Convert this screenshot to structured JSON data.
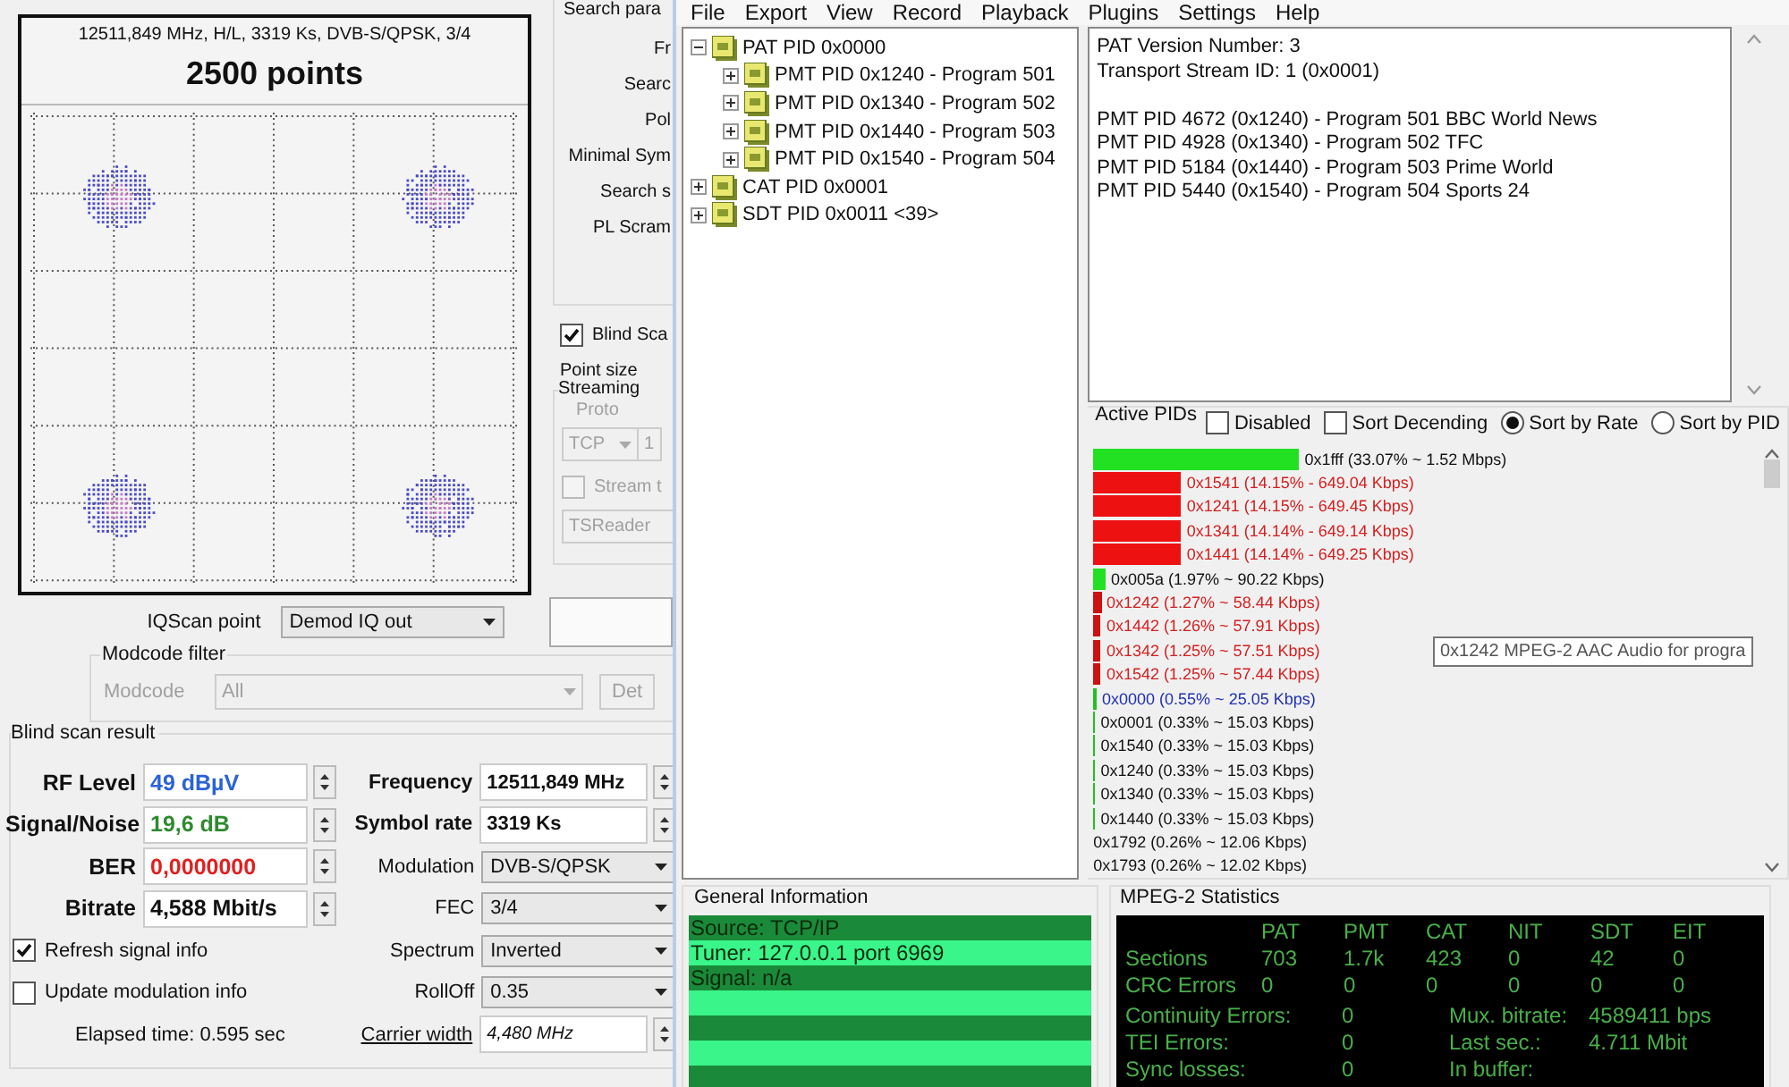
{
  "constellation": {
    "caption": "12511,849 MHz, H/L, 3319 Ks, DVB-S/QPSK, 3/4",
    "title": "2500 points"
  },
  "search_params": {
    "title": "Search para",
    "labels": [
      "Fr",
      "Searc",
      "Pol",
      "Minimal Sym",
      "Search s",
      "PL Scram"
    ]
  },
  "blind_scan": {
    "label": "Blind Sca",
    "checked": true
  },
  "point_size": "Point size",
  "streaming": {
    "title": "Streaming",
    "proto_label": "Proto",
    "proto_value": "TCP",
    "port_value": "1",
    "stream_checkbox": {
      "label": "Stream t",
      "checked": false
    },
    "target": "TSReader"
  },
  "iqscan": {
    "label": "IQScan point",
    "value": "Demod IQ out"
  },
  "modcode_filter": {
    "title": "Modcode filter",
    "label": "Modcode",
    "value": "All",
    "button": "Det"
  },
  "blind_scan_result": {
    "title": "Blind scan result",
    "left_fields": [
      {
        "label": "RF Level",
        "value": "49 dBµV",
        "color": "#2a62d8"
      },
      {
        "label": "Signal/Noise",
        "value": "19,6 dB",
        "color": "#2e8a2e"
      },
      {
        "label": "BER",
        "value": "0,0000000",
        "color": "#e02020"
      },
      {
        "label": "Bitrate",
        "value": "4,588 Mbit/s",
        "color": "#111111"
      }
    ],
    "checkboxes": [
      {
        "label": "Refresh signal info",
        "checked": true
      },
      {
        "label": "Update modulation info",
        "checked": false
      }
    ],
    "elapsed": "Elapsed time: 0.595 sec",
    "right_fields": [
      {
        "kind": "spin",
        "label": "Frequency",
        "value": "12511,849 MHz"
      },
      {
        "kind": "spin",
        "label": "Symbol rate",
        "value": "3319 Ks"
      },
      {
        "kind": "select",
        "label": "Modulation",
        "value": "DVB-S/QPSK"
      },
      {
        "kind": "select",
        "label": "FEC",
        "value": "3/4"
      },
      {
        "kind": "select",
        "label": "Spectrum",
        "value": "Inverted"
      },
      {
        "kind": "select",
        "label": "RollOff",
        "value": "0.35"
      },
      {
        "kind": "link-spin",
        "label": "Carrier width",
        "value": "4,480 MHz"
      }
    ]
  },
  "menu": [
    "File",
    "Export",
    "View",
    "Record",
    "Playback",
    "Plugins",
    "Settings",
    "Help"
  ],
  "tree": [
    {
      "label": "PAT PID 0x0000",
      "expanded": true,
      "children": [
        {
          "label": "PMT PID 0x1240 - Program 501",
          "expanded": false
        },
        {
          "label": "PMT PID 0x1340 - Program 502",
          "expanded": false
        },
        {
          "label": "PMT PID 0x1440 - Program 503",
          "expanded": false
        },
        {
          "label": "PMT PID 0x1540 - Program 504",
          "expanded": false
        }
      ]
    },
    {
      "label": "CAT PID 0x0001",
      "expanded": false
    },
    {
      "label": "SDT PID 0x0011 <39>",
      "expanded": false
    }
  ],
  "info_panel": {
    "blocks": [
      [
        "PAT Version Number: 3",
        "Transport Stream ID: 1 (0x0001)"
      ],
      [
        "PMT PID 4672 (0x1240) - Program 501 BBC World News",
        "PMT PID 4928 (0x1340) - Program 502 TFC",
        "PMT PID 5184 (0x1440) - Program 503 Prime World",
        "PMT PID 5440 (0x1540) - Program 504 Sports 24"
      ]
    ]
  },
  "active_pids": {
    "title": "Active PIDs",
    "checkboxes": [
      {
        "label": "Disabled",
        "checked": false
      },
      {
        "label": "Sort Decending",
        "checked": false
      }
    ],
    "sort_options": [
      {
        "label": "Sort by Rate",
        "selected": true
      },
      {
        "label": "Sort by PID",
        "selected": false
      }
    ],
    "pids": [
      {
        "text": "0x1fff (33.07% ~ 1.52 Mbps)",
        "level": 0.3307,
        "color": "#22e022",
        "kind": "other"
      },
      {
        "text": "0x1541 (14.15% - 649.04 Kbps)",
        "level": 0.1415,
        "color": "#ee1111",
        "kind": "audio"
      },
      {
        "text": "0x1241 (14.15% - 649.45 Kbps)",
        "level": 0.1415,
        "color": "#ee1111",
        "kind": "audio"
      },
      {
        "text": "0x1341 (14.14% - 649.14 Kbps)",
        "level": 0.1414,
        "color": "#ee1111",
        "kind": "audio"
      },
      {
        "text": "0x1441 (14.14% - 649.25 Kbps)",
        "level": 0.1414,
        "color": "#ee1111",
        "kind": "audio"
      },
      {
        "text": "0x005a (1.97% ~ 90.22 Kbps)",
        "level": 0.0197,
        "color": "#22e022",
        "kind": "other"
      },
      {
        "text": "0x1242 (1.27% ~ 58.44 Kbps)",
        "level": 0.0127,
        "color": "#cc1111",
        "kind": "audio"
      },
      {
        "text": "0x1442 (1.26% ~ 57.91 Kbps)",
        "level": 0.0126,
        "color": "#cc1111",
        "kind": "audio"
      },
      {
        "text": "0x1342 (1.25% ~ 57.51 Kbps)",
        "level": 0.0125,
        "color": "#cc1111",
        "kind": "audio"
      },
      {
        "text": "0x1542 (1.25% ~ 57.44 Kbps)",
        "level": 0.0125,
        "color": "#cc1111",
        "kind": "audio"
      },
      {
        "text": "0x0000 (0.55% ~ 25.05 Kbps)",
        "level": 0.0055,
        "color": "#22c022",
        "kind": "pat"
      },
      {
        "text": "0x0001 (0.33% ~ 15.03 Kbps)",
        "level": 0.0033,
        "color": "#22c022",
        "kind": "other"
      },
      {
        "text": "0x1540 (0.33% ~ 15.03 Kbps)",
        "level": 0.0033,
        "color": "#22c022",
        "kind": "other"
      },
      {
        "text": "0x1240 (0.33% ~ 15.03 Kbps)",
        "level": 0.0033,
        "color": "#22c022",
        "kind": "other"
      },
      {
        "text": "0x1340 (0.33% ~ 15.03 Kbps)",
        "level": 0.0033,
        "color": "#22c022",
        "kind": "other"
      },
      {
        "text": "0x1440 (0.33% ~ 15.03 Kbps)",
        "level": 0.0033,
        "color": "#22c022",
        "kind": "other"
      },
      {
        "text": "0x1792 (0.26% ~ 12.06 Kbps)",
        "kind": "other"
      },
      {
        "text": "0x1793 (0.26% ~ 12.02 Kbps)",
        "kind": "other"
      }
    ],
    "tooltip": "0x1242 MPEG-2 AAC Audio for progra"
  },
  "general_info": {
    "title": "General Information",
    "lines": [
      "Source: TCP/IP",
      "Tuner: 127.0.0.1 port 6969",
      "Signal: n/a"
    ]
  },
  "mpeg2_stats": {
    "title": "MPEG-2 Statistics",
    "columns": [
      "PAT",
      "PMT",
      "CAT",
      "NIT",
      "SDT",
      "EIT"
    ],
    "rows": [
      {
        "label": "Sections",
        "values": [
          "703",
          "1.7k",
          "423",
          "0",
          "42",
          "0"
        ]
      },
      {
        "label": "CRC Errors",
        "values": [
          "0",
          "0",
          "0",
          "0",
          "0",
          "0"
        ]
      }
    ],
    "counters": [
      {
        "label": "Continuity Errors:",
        "value": "0"
      },
      {
        "label": "TEI Errors:",
        "value": "0"
      },
      {
        "label": "Sync losses:",
        "value": "0"
      }
    ],
    "bitrates": [
      {
        "label": "Mux. bitrate:",
        "value": "4589411 bps"
      },
      {
        "label": "Last sec.:",
        "value": "4.711 Mbit"
      },
      {
        "label": "In buffer:"
      }
    ]
  }
}
